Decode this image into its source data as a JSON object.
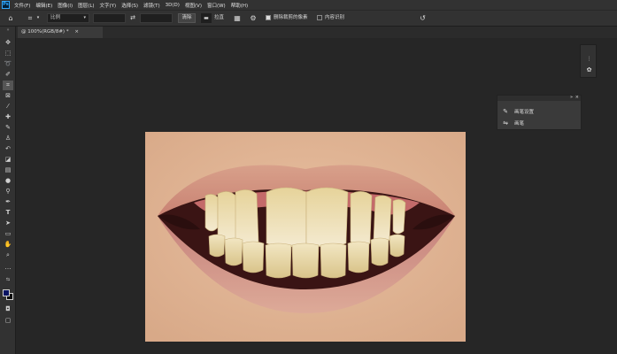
{
  "app": {
    "logo": "Ps"
  },
  "menu": [
    "文件(F)",
    "编辑(E)",
    "图像(I)",
    "图层(L)",
    "文字(Y)",
    "选择(S)",
    "滤镜(T)",
    "3D(D)",
    "视图(V)",
    "窗口(W)",
    "帮助(H)"
  ],
  "options": {
    "ratio_select": "比例",
    "width_value": "",
    "height_value": "",
    "clear_button": "清除",
    "straighten_label": "拉直",
    "delete_pixels_label": "删除裁剪的像素",
    "delete_pixels_checked": true,
    "content_aware_label": "内容识别",
    "content_aware_checked": false
  },
  "document": {
    "tab_title": "@ 100%(RGB/8#) *",
    "close": "×"
  },
  "panel": {
    "items": [
      {
        "label": "画笔设置",
        "icon": "brush-settings-icon"
      },
      {
        "label": "画笔",
        "icon": "brush-icon"
      }
    ],
    "collapse": "»",
    "close": "×"
  },
  "toolbar": {
    "tools": [
      "move-icon",
      "marquee-icon",
      "lasso-icon",
      "quick-select-icon",
      "crop-icon",
      "frame-icon",
      "eyedropper-icon",
      "healing-brush-icon",
      "brush-icon",
      "clone-stamp-icon",
      "history-brush-icon",
      "eraser-icon",
      "gradient-icon",
      "blur-icon",
      "dodge-icon",
      "pen-icon",
      "type-icon",
      "path-select-icon",
      "rectangle-icon",
      "hand-icon",
      "zoom-icon",
      "more-tools-icon"
    ],
    "foreground_color": "#0a1463",
    "background_color": "#0c0c0c"
  },
  "colors": {
    "bg": "#262626",
    "panel": "#323232",
    "accent": "#31a8ff"
  }
}
